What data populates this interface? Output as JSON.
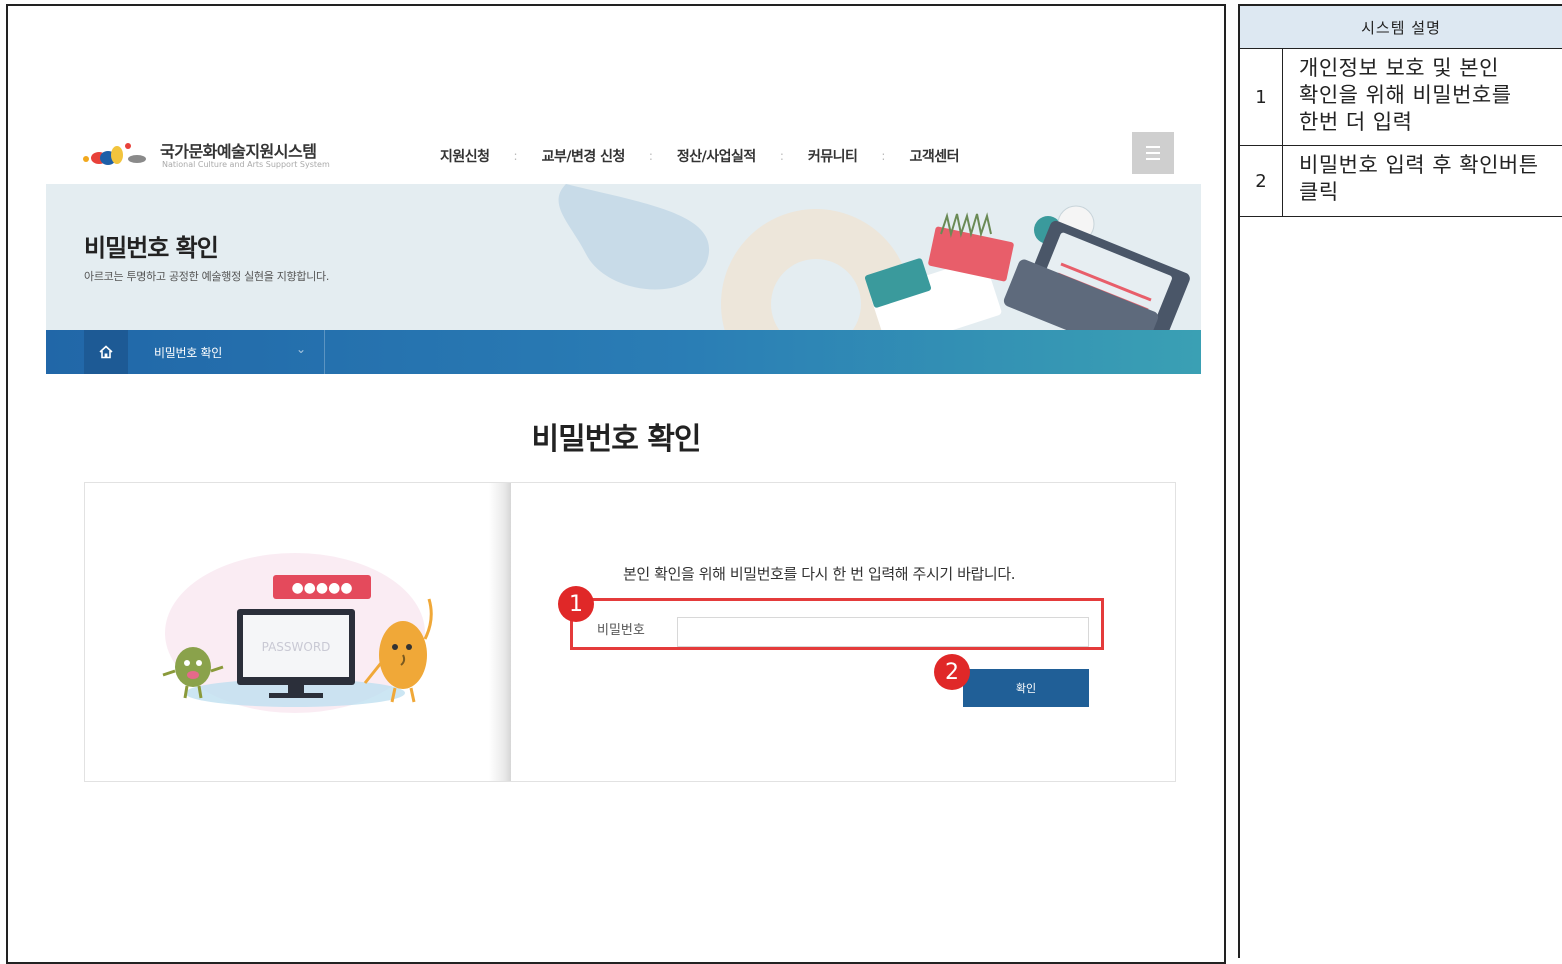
{
  "site": {
    "logo_title": "국가문화예술지원시스템",
    "logo_subtitle": "National Culture and Arts Support System"
  },
  "gnb": {
    "items": [
      "지원신청",
      "교부/변경 신청",
      "정산/사업실적",
      "커뮤니티",
      "고객센터"
    ],
    "separator": ":"
  },
  "hero": {
    "title": "비밀번호 확인",
    "subtitle": "아르코는 투명하고 공정한 예술행정 실현을 지향합니다."
  },
  "locbar": {
    "current": "비밀번호 확인"
  },
  "main": {
    "heading": "비밀번호 확인",
    "guide": "본인 확인을 위해 비밀번호를 다시 한 번 입력해 주시기 바랍니다.",
    "password_label": "비밀번호",
    "password_value": "",
    "confirm_button": "확인",
    "illustration_text": "PASSWORD"
  },
  "markers": [
    "1",
    "2"
  ],
  "colors": {
    "highlight": "#e43b3b",
    "marker": "#e02828",
    "button": "#205f97",
    "locbar_start": "#2167a8",
    "locbar_end": "#3aa0b4",
    "table_header": "#dde8f2"
  },
  "description": {
    "header": "시스템 설명",
    "rows": [
      {
        "num": "1",
        "text": "개인정보 보호 및 본인 확인을 위해 비밀번호를 한번 더 입력"
      },
      {
        "num": "2",
        "text": "비밀번호 입력 후 확인버튼 클릭"
      }
    ]
  }
}
